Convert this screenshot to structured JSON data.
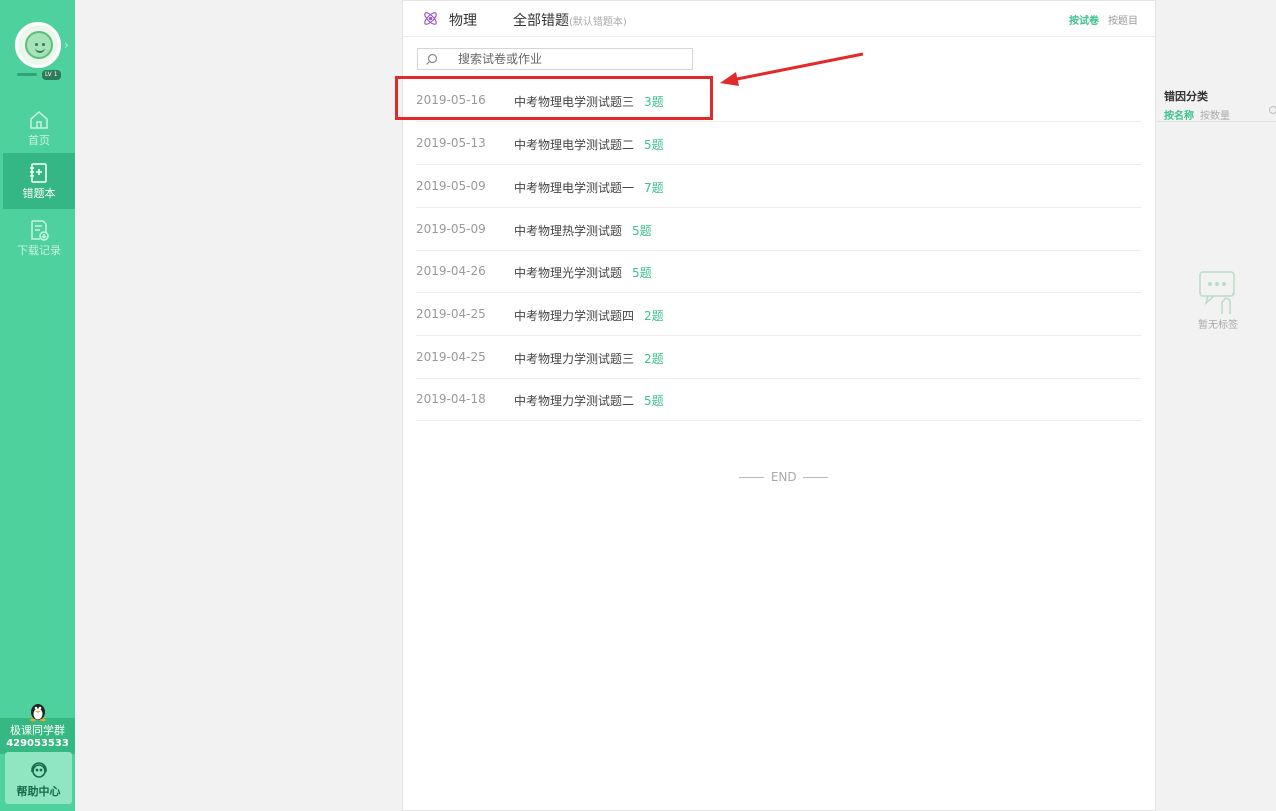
{
  "sidebar": {
    "level_badge": "LV 1",
    "nav": [
      {
        "label": "首页",
        "icon": "home-icon",
        "active": false
      },
      {
        "label": "错题本",
        "icon": "notebook-icon",
        "active": true
      },
      {
        "label": "下载记录",
        "icon": "download-record-icon",
        "active": false
      }
    ],
    "qq_group": {
      "name": "极课同学群",
      "number": "429053533"
    },
    "help": {
      "label": "帮助中心"
    }
  },
  "header": {
    "subject": "物理",
    "title": "全部错题",
    "subtitle": "(默认错题本)",
    "sort_by_paper": "按试卷",
    "sort_by_question": "按题目"
  },
  "search": {
    "placeholder": "搜索试卷或作业"
  },
  "papers": [
    {
      "date": "2019-05-16",
      "title": "中考物理电学测试题三",
      "count": "3题"
    },
    {
      "date": "2019-05-13",
      "title": "中考物理电学测试题二",
      "count": "5题"
    },
    {
      "date": "2019-05-09",
      "title": "中考物理电学测试题一",
      "count": "7题"
    },
    {
      "date": "2019-05-09",
      "title": "中考物理热学测试题",
      "count": "5题"
    },
    {
      "date": "2019-04-26",
      "title": "中考物理光学测试题",
      "count": "5题"
    },
    {
      "date": "2019-04-25",
      "title": "中考物理力学测试题四",
      "count": "2题"
    },
    {
      "date": "2019-04-25",
      "title": "中考物理力学测试题三",
      "count": "2题"
    },
    {
      "date": "2019-04-18",
      "title": "中考物理力学测试题二",
      "count": "5题"
    }
  ],
  "end_text": "END",
  "right_panel": {
    "title": "错因分类",
    "tab_by_name": "按名称",
    "tab_by_count": "按数量",
    "empty_text": "暂无标签"
  },
  "colors": {
    "sidebar": "#4fd19d",
    "accent": "#3cc28d",
    "highlight": "#e32a2a"
  }
}
